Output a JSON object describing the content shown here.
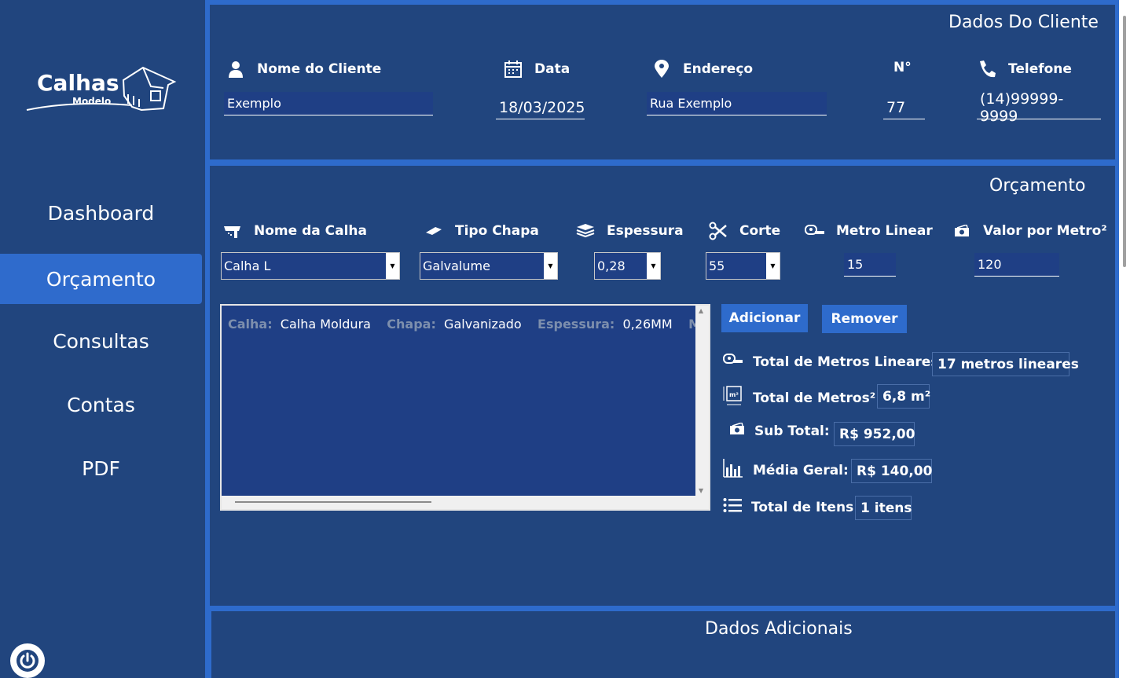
{
  "sidebar": {
    "logo_title": "Calhas",
    "logo_subtitle": "Modelo",
    "nav": [
      {
        "label": "Dashboard",
        "active": false
      },
      {
        "label": "Orçamento",
        "active": true
      },
      {
        "label": "Consultas",
        "active": false
      },
      {
        "label": "Contas",
        "active": false
      },
      {
        "label": "PDF",
        "active": false
      }
    ],
    "power_icon": "power-icon"
  },
  "cliente": {
    "title": "Dados Do Cliente",
    "nome_label": "Nome do Cliente",
    "nome_value": "Exemplo",
    "data_label": "Data",
    "data_value": "18/03/2025",
    "endereco_label": "Endereço",
    "endereco_value": "Rua Exemplo",
    "numero_label": "N°",
    "numero_value": "77",
    "telefone_label": "Telefone",
    "telefone_value": "(14)99999-9999"
  },
  "orcamento": {
    "title": "Orçamento",
    "calha_label": "Nome da Calha",
    "calha_value": "Calha L",
    "chapa_label": "Tipo Chapa",
    "chapa_value": "Galvalume",
    "espessura_label": "Espessura",
    "espessura_value": "0,28",
    "corte_label": "Corte",
    "corte_value": "55",
    "metro_label": "Metro Linear",
    "metro_value": "15",
    "valor_label": "Valor por Metro²",
    "valor_value": "120",
    "list_item": {
      "calha_key": "Calha:",
      "calha_val": "Calha Moldura",
      "chapa_key": "Chapa:",
      "chapa_val": "Galvanizado",
      "esp_key": "Espessura:",
      "esp_val": "0,26MM",
      "ml_key": "M L"
    },
    "add_button": "Adicionar",
    "remove_button": "Remover",
    "totals": {
      "metros_lineares_label": "Total de Metros Lineares:",
      "metros_lineares_value": "17 metros lineares",
      "metros2_label": "Total de Metros² :",
      "metros2_value": "6,8 m²",
      "subtotal_label": "Sub Total:",
      "subtotal_value": "R$ 952,00",
      "media_label": "Média Geral:",
      "media_value": "R$ 140,00",
      "itens_label": "Total de Itens:",
      "itens_value": "1 itens"
    }
  },
  "adicionais": {
    "title": "Dados Adicionais"
  }
}
